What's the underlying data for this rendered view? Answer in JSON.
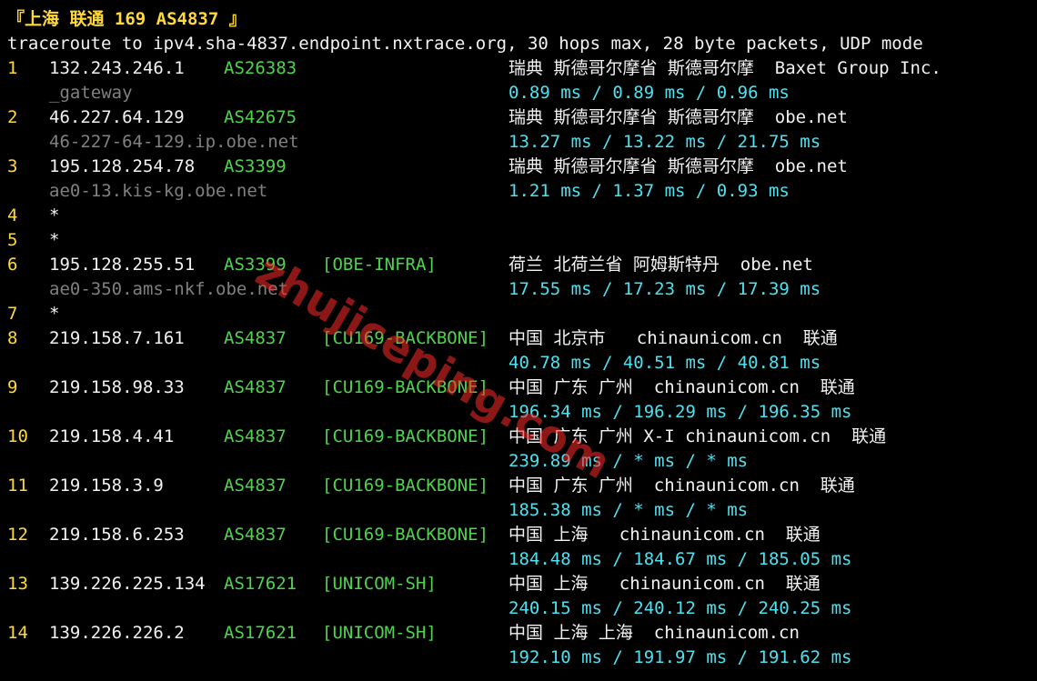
{
  "header": {
    "title": "『上海 联通 169 AS4837 』",
    "command": "traceroute to ipv4.sha-4837.endpoint.nxtrace.org, 30 hops max, 28 byte packets, UDP mode"
  },
  "hops": [
    {
      "n": "1",
      "ip": "132.243.246.1",
      "asn": "AS26383",
      "tag": "",
      "geo": "瑞典 斯德哥尔摩省 斯德哥尔摩  Baxet Group Inc.",
      "host": "_gateway",
      "rtt": "0.89 ms / 0.89 ms / 0.96 ms"
    },
    {
      "n": "2",
      "ip": "46.227.64.129",
      "asn": "AS42675",
      "tag": "",
      "geo": "瑞典 斯德哥尔摩省 斯德哥尔摩  obe.net",
      "host": "46-227-64-129.ip.obe.net",
      "rtt": "13.27 ms / 13.22 ms / 21.75 ms"
    },
    {
      "n": "3",
      "ip": "195.128.254.78",
      "asn": "AS3399",
      "tag": "",
      "geo": "瑞典 斯德哥尔摩省 斯德哥尔摩  obe.net",
      "host": "ae0-13.kis-kg.obe.net",
      "rtt": "1.21 ms / 1.37 ms / 0.93 ms"
    },
    {
      "n": "4",
      "ip": "*",
      "asn": "",
      "tag": "",
      "geo": "",
      "host": "",
      "rtt": ""
    },
    {
      "n": "5",
      "ip": "*",
      "asn": "",
      "tag": "",
      "geo": "",
      "host": "",
      "rtt": ""
    },
    {
      "n": "6",
      "ip": "195.128.255.51",
      "asn": "AS3399",
      "tag": "[OBE-INFRA]",
      "geo": "荷兰 北荷兰省 阿姆斯特丹  obe.net",
      "host": "ae0-350.ams-nkf.obe.net",
      "rtt": "17.55 ms / 17.23 ms / 17.39 ms"
    },
    {
      "n": "7",
      "ip": "*",
      "asn": "",
      "tag": "",
      "geo": "",
      "host": "",
      "rtt": ""
    },
    {
      "n": "8",
      "ip": "219.158.7.161",
      "asn": "AS4837",
      "tag": "[CU169-BACKBONE]",
      "geo": "中国 北京市   chinaunicom.cn  联通",
      "host": "",
      "rtt": "40.78 ms / 40.51 ms / 40.81 ms"
    },
    {
      "n": "9",
      "ip": "219.158.98.33",
      "asn": "AS4837",
      "tag": "[CU169-BACKBONE]",
      "geo": "中国 广东 广州  chinaunicom.cn  联通",
      "host": "",
      "rtt": "196.34 ms / 196.29 ms / 196.35 ms"
    },
    {
      "n": "10",
      "ip": "219.158.4.41",
      "asn": "AS4837",
      "tag": "[CU169-BACKBONE]",
      "geo": "中国 广东 广州 X-I chinaunicom.cn  联通",
      "host": "",
      "rtt": "239.89 ms / * ms / * ms"
    },
    {
      "n": "11",
      "ip": "219.158.3.9",
      "asn": "AS4837",
      "tag": "[CU169-BACKBONE]",
      "geo": "中国 广东 广州  chinaunicom.cn  联通",
      "host": "",
      "rtt": "185.38 ms / * ms / * ms"
    },
    {
      "n": "12",
      "ip": "219.158.6.253",
      "asn": "AS4837",
      "tag": "[CU169-BACKBONE]",
      "geo": "中国 上海   chinaunicom.cn  联通",
      "host": "",
      "rtt": "184.48 ms / 184.67 ms / 185.05 ms"
    },
    {
      "n": "13",
      "ip": "139.226.225.134",
      "asn": "AS17621",
      "tag": "[UNICOM-SH]",
      "geo": "中国 上海   chinaunicom.cn  联通",
      "host": "",
      "rtt": "240.15 ms / 240.12 ms / 240.25 ms"
    },
    {
      "n": "14",
      "ip": "139.226.226.2",
      "asn": "AS17621",
      "tag": "[UNICOM-SH]",
      "geo": "中国 上海 上海  chinaunicom.cn",
      "host": "",
      "rtt": "192.10 ms / 191.97 ms / 191.62 ms"
    }
  ],
  "watermark": "zhujiceping.com",
  "colors": {
    "background": "#000000",
    "hop_number": "#ffd93b",
    "ip": "#f2f2f2",
    "asn": "#4fd34f",
    "rtt": "#4ee1f0",
    "hostname": "#808080",
    "watermark": "#ff2a2a"
  }
}
